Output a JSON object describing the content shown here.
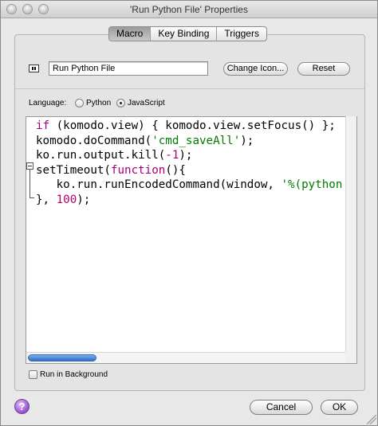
{
  "window": {
    "title": "'Run Python File' Properties"
  },
  "tabs": [
    {
      "label": "Macro",
      "active": true
    },
    {
      "label": "Key Binding",
      "active": false
    },
    {
      "label": "Triggers",
      "active": false
    }
  ],
  "macro": {
    "name_value": "Run Python File",
    "change_icon_label": "Change Icon...",
    "reset_label": "Reset",
    "language_label": "Language:",
    "language_options": [
      "Python",
      "JavaScript"
    ],
    "language_selected": "JavaScript",
    "code_lines": [
      "if (komodo.view) { komodo.view.setFocus() };",
      "komodo.doCommand('cmd_saveAll');",
      "ko.run.output.kill(-1);",
      "setTimeout(function(){",
      "   ko.run.runEncodedCommand(window, '%(python",
      "}, 100);"
    ],
    "run_in_background_label": "Run in Background",
    "run_in_background_checked": false
  },
  "footer": {
    "help_label": "?",
    "cancel_label": "Cancel",
    "ok_label": "OK"
  },
  "colors": {
    "keyword": "#a0007a",
    "string": "#007a00",
    "number": "#b8006a",
    "scroll_thumb": "#2f6fc9",
    "help_button": "#9f5bd8"
  }
}
